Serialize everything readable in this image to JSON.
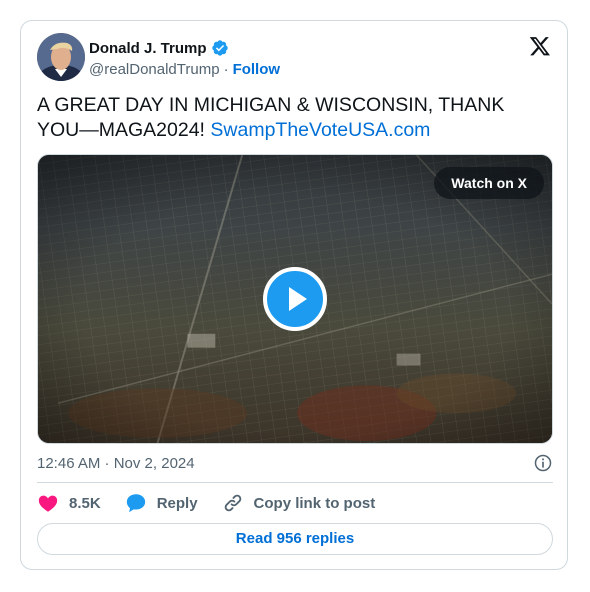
{
  "author": {
    "display_name": "Donald J. Trump",
    "handle": "@realDonaldTrump",
    "separator": "·",
    "follow_label": "Follow",
    "avatar_icon": "profile-photo",
    "verified_icon": "verified-badge-icon",
    "verified_color": "#1d9bf0"
  },
  "platform_logo": "x-logo-icon",
  "tweet": {
    "text": "A GREAT DAY IN MICHIGAN & WISCONSIN, THANK YOU—MAGA2024! ",
    "link_text": "SwampTheVoteUSA.com"
  },
  "media": {
    "watch_label": "Watch on X",
    "play_icon": "play-icon",
    "description_icon": "aerial-city-video-thumbnail"
  },
  "meta": {
    "timestamp": "12:46 AM · Nov 2, 2024",
    "info_icon": "info-icon"
  },
  "actions": {
    "like_count": "8.5K",
    "reply_label": "Reply",
    "copy_label": "Copy link to post"
  },
  "read_replies_label": "Read 956 replies",
  "colors": {
    "link": "#006fd6",
    "like": "#f91880",
    "reply": "#1d9bf0",
    "secondary_text": "#536471",
    "border": "#cfd9de"
  }
}
